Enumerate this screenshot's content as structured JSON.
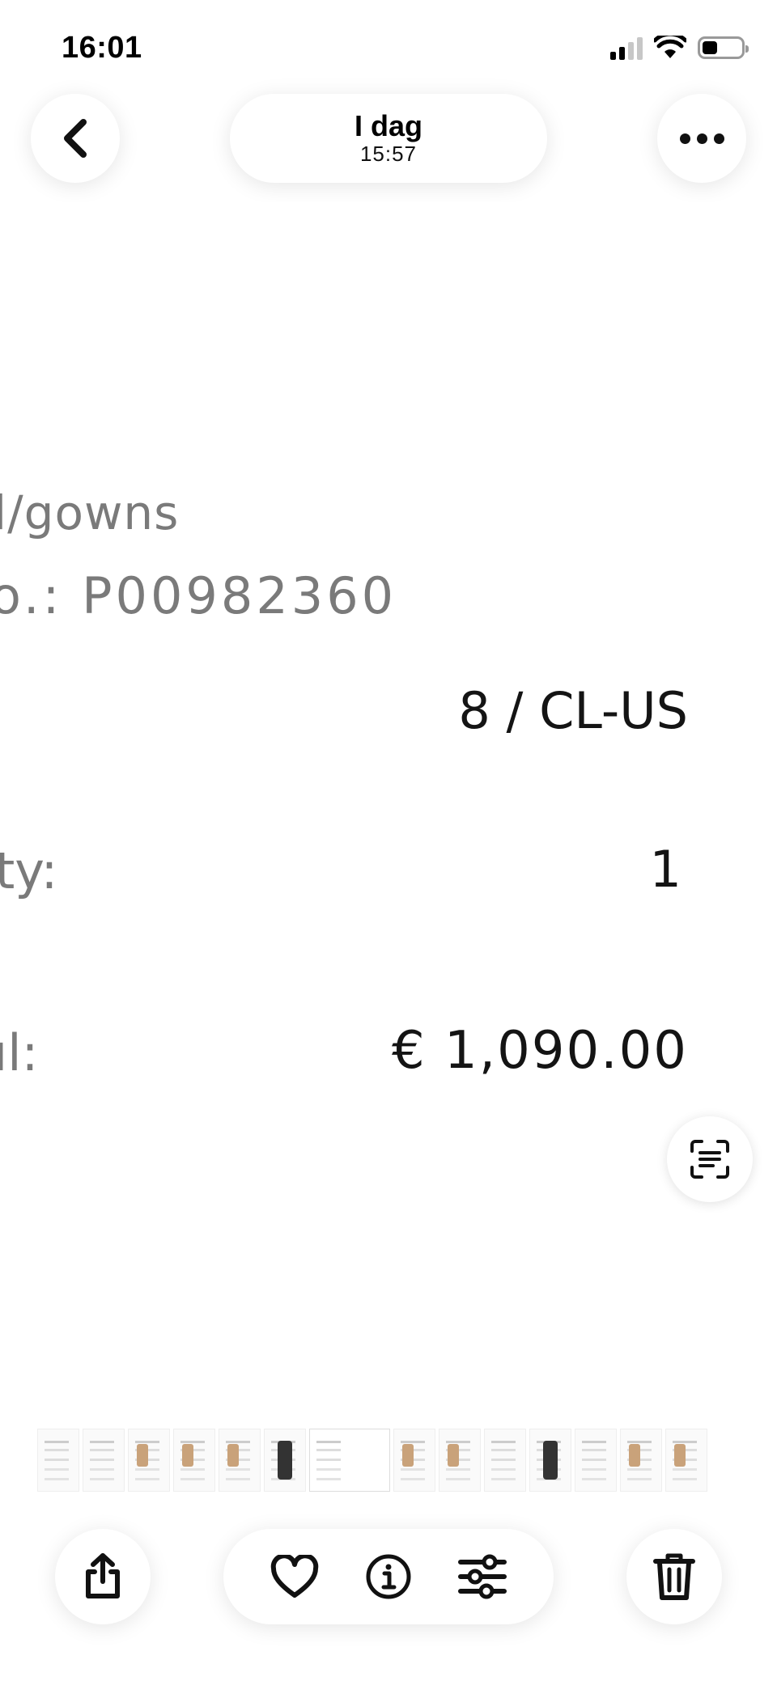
{
  "status_bar": {
    "time": "16:01",
    "icons": [
      "cellular-signal-icon",
      "wifi-icon",
      "battery-icon"
    ],
    "battery_level": 0.4
  },
  "header": {
    "title": "I dag",
    "subtitle": "15:57",
    "icons": [
      "chevron-left-icon",
      "more-dots-icon"
    ]
  },
  "photo": {
    "category_text": "l/gowns",
    "sku_text": "o.: P00982360",
    "size_value": "8 / CL-US",
    "quantity_label": "ty:",
    "quantity_value": "1",
    "total_label": "ıl:",
    "total_value": "€ 1,090.00"
  },
  "live_text": {
    "icon": "live-text-icon"
  },
  "thumbnails": {
    "count": 14,
    "selected_index": 6
  },
  "toolbar": {
    "icons": [
      "share-icon",
      "heart-icon",
      "info-icon",
      "adjust-sliders-icon",
      "trash-icon"
    ]
  },
  "colors": {
    "background": "#ffffff",
    "text": "#111111",
    "muted_text": "#7a7a7a"
  }
}
